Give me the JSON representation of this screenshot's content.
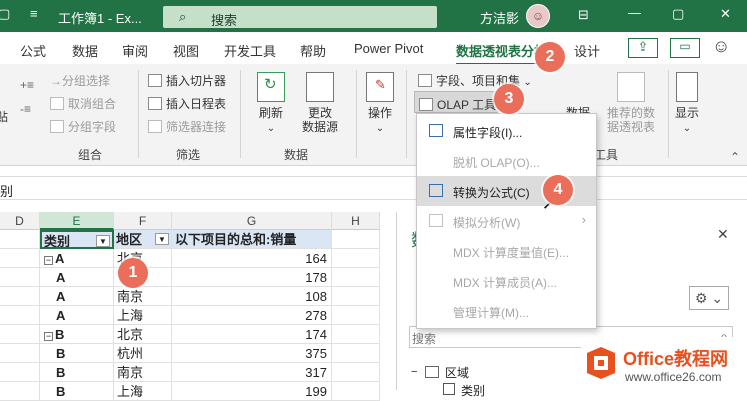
{
  "titlebar": {
    "app_title": "工作簿1 - Ex...",
    "search_placeholder": "搜索",
    "user_name": "方洁影"
  },
  "tabs": [
    {
      "label": "公式"
    },
    {
      "label": "数据"
    },
    {
      "label": "审阅"
    },
    {
      "label": "视图"
    },
    {
      "label": "开发工具"
    },
    {
      "label": "帮助"
    },
    {
      "label": "Power Pivot"
    },
    {
      "label": "数据透视表分析"
    },
    {
      "label": "设计"
    }
  ],
  "ribbon": {
    "group_combine": {
      "label": "组合",
      "items": [
        "→分组选择",
        "取消组合",
        "分组字段"
      ]
    },
    "group_filter": {
      "label": "筛选",
      "items": [
        "插入切片器",
        "插入日程表",
        "筛选器连接"
      ]
    },
    "group_data": {
      "label": "数据",
      "refresh": "刷新",
      "change_source_1": "更改",
      "change_source_2": "数据源"
    },
    "actions": "操作",
    "fields_items_sets": "字段、项目和集",
    "olap_tools": "OLAP 工具",
    "recommended_1": "推荐的数",
    "recommended_2": "据透视表",
    "data_cut": "数据",
    "tools_cut": "工具",
    "show": "显示",
    "left_cut": "贴"
  },
  "formula_bar": {
    "name_cut": "别"
  },
  "grid": {
    "columns": [
      "D",
      "E",
      "F",
      "G",
      "H"
    ],
    "headers": [
      "类别",
      "地区",
      "以下项目的总和:销量"
    ],
    "rows": [
      {
        "category": "A",
        "region": "北京",
        "value": "164",
        "group": true
      },
      {
        "category": "A",
        "region": "",
        "value": "178",
        "group": false
      },
      {
        "category": "A",
        "region": "南京",
        "value": "108",
        "group": false
      },
      {
        "category": "A",
        "region": "上海",
        "value": "278",
        "group": false
      },
      {
        "category": "B",
        "region": "北京",
        "value": "174",
        "group": true
      },
      {
        "category": "B",
        "region": "杭州",
        "value": "375",
        "group": false
      },
      {
        "category": "B",
        "region": "南京",
        "value": "317",
        "group": false
      },
      {
        "category": "B",
        "region": "上海",
        "value": "199",
        "group": false
      }
    ]
  },
  "pane": {
    "title_cut": "数",
    "search_placeholder": "搜索",
    "area_label": "区域",
    "field_cut": "类别"
  },
  "menu": {
    "items": [
      {
        "label": "属性字段(I)...",
        "disabled": false
      },
      {
        "label": "脱机 OLAP(O)...",
        "disabled": true
      },
      {
        "label": "转换为公式(C)",
        "disabled": false,
        "highlighted": true
      },
      {
        "label": "模拟分析(W)",
        "disabled": true,
        "submenu": true
      },
      {
        "label": "MDX 计算度量值(E)...",
        "disabled": true
      },
      {
        "label": "MDX 计算成员(A)...",
        "disabled": true
      },
      {
        "label": "管理计算(M)...",
        "disabled": true
      }
    ]
  },
  "badges": [
    "1",
    "2",
    "3",
    "4"
  ],
  "watermark": {
    "brand": "Office教程网",
    "url": "www.office26.com"
  },
  "colors": {
    "excel_green": "#217346",
    "badge": "#ea6e5a",
    "header_fill": "#dbe6f4",
    "logo_orange": "#e8501e"
  }
}
